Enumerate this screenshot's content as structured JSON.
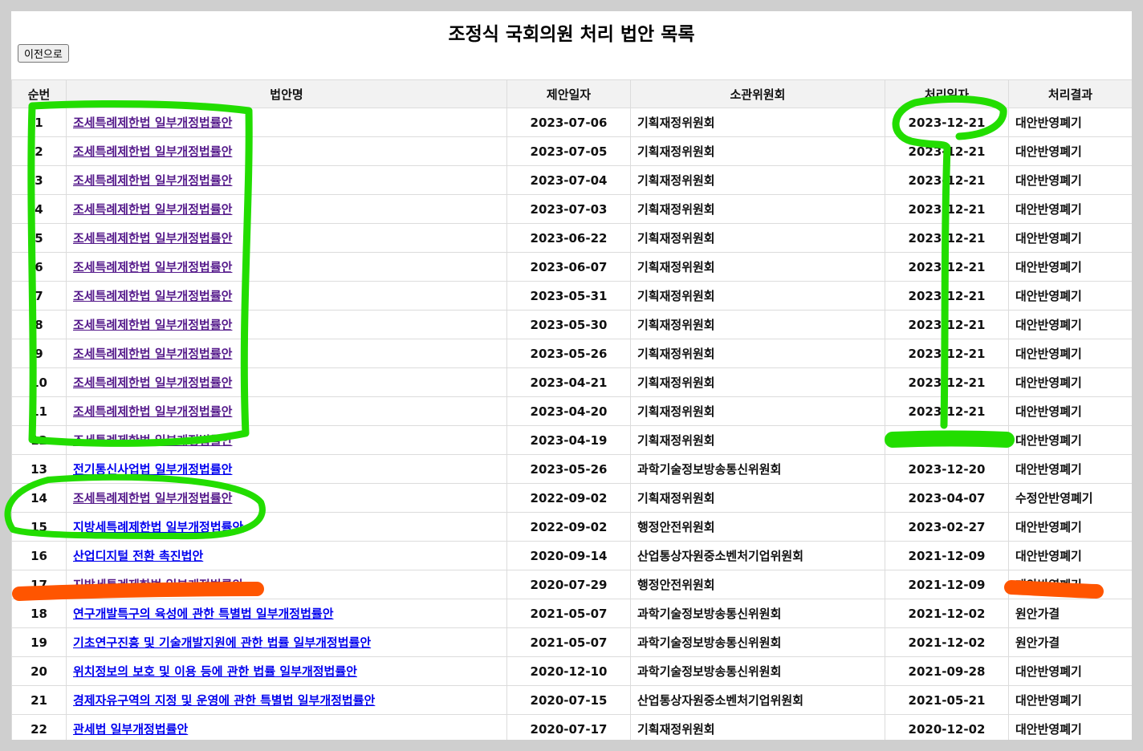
{
  "page": {
    "title": "조정식 국회의원 처리 법안 목록",
    "back_label": "이전으로"
  },
  "table": {
    "headers": {
      "no": "순번",
      "name": "법안명",
      "proposed": "제안일자",
      "committee": "소관위원회",
      "processed": "처리일자",
      "result": "처리결과"
    },
    "rows": [
      {
        "no": "1",
        "name": "조세특례제한법 일부개정법률안",
        "proposed": "2023-07-06",
        "committee": "기획재정위원회",
        "processed": "2023-12-21",
        "result": "대안반영폐기",
        "visited": true
      },
      {
        "no": "2",
        "name": "조세특례제한법 일부개정법률안",
        "proposed": "2023-07-05",
        "committee": "기획재정위원회",
        "processed": "2023-12-21",
        "result": "대안반영폐기",
        "visited": true
      },
      {
        "no": "3",
        "name": "조세특례제한법 일부개정법률안",
        "proposed": "2023-07-04",
        "committee": "기획재정위원회",
        "processed": "2023-12-21",
        "result": "대안반영폐기",
        "visited": true
      },
      {
        "no": "4",
        "name": "조세특례제한법 일부개정법률안",
        "proposed": "2023-07-03",
        "committee": "기획재정위원회",
        "processed": "2023-12-21",
        "result": "대안반영폐기",
        "visited": true
      },
      {
        "no": "5",
        "name": "조세특례제한법 일부개정법률안",
        "proposed": "2023-06-22",
        "committee": "기획재정위원회",
        "processed": "2023-12-21",
        "result": "대안반영폐기",
        "visited": true
      },
      {
        "no": "6",
        "name": "조세특례제한법 일부개정법률안",
        "proposed": "2023-06-07",
        "committee": "기획재정위원회",
        "processed": "2023-12-21",
        "result": "대안반영폐기",
        "visited": true
      },
      {
        "no": "7",
        "name": "조세특례제한법 일부개정법률안",
        "proposed": "2023-05-31",
        "committee": "기획재정위원회",
        "processed": "2023-12-21",
        "result": "대안반영폐기",
        "visited": true
      },
      {
        "no": "8",
        "name": "조세특례제한법 일부개정법률안",
        "proposed": "2023-05-30",
        "committee": "기획재정위원회",
        "processed": "2023-12-21",
        "result": "대안반영폐기",
        "visited": true
      },
      {
        "no": "9",
        "name": "조세특례제한법 일부개정법률안",
        "proposed": "2023-05-26",
        "committee": "기획재정위원회",
        "processed": "2023-12-21",
        "result": "대안반영폐기",
        "visited": true
      },
      {
        "no": "10",
        "name": "조세특례제한법 일부개정법률안",
        "proposed": "2023-04-21",
        "committee": "기획재정위원회",
        "processed": "2023-12-21",
        "result": "대안반영폐기",
        "visited": true
      },
      {
        "no": "11",
        "name": "조세특례제한법 일부개정법률안",
        "proposed": "2023-04-20",
        "committee": "기획재정위원회",
        "processed": "2023-12-21",
        "result": "대안반영폐기",
        "visited": true
      },
      {
        "no": "12",
        "name": "조세특례제한법 일부개정법률안",
        "proposed": "2023-04-19",
        "committee": "기획재정위원회",
        "processed": "2023-12-21",
        "result": "대안반영폐기",
        "visited": true
      },
      {
        "no": "13",
        "name": "전기통신사업법 일부개정법률안",
        "proposed": "2023-05-26",
        "committee": "과학기술정보방송통신위원회",
        "processed": "2023-12-20",
        "result": "대안반영폐기",
        "visited": false
      },
      {
        "no": "14",
        "name": "조세특례제한법 일부개정법률안",
        "proposed": "2022-09-02",
        "committee": "기획재정위원회",
        "processed": "2023-04-07",
        "result": "수정안반영폐기",
        "visited": true
      },
      {
        "no": "15",
        "name": "지방세특례제한법 일부개정법률안",
        "proposed": "2022-09-02",
        "committee": "행정안전위원회",
        "processed": "2023-02-27",
        "result": "대안반영폐기",
        "visited": false
      },
      {
        "no": "16",
        "name": "산업디지털 전환 촉진법안",
        "proposed": "2020-09-14",
        "committee": "산업통상자원중소벤처기업위원회",
        "processed": "2021-12-09",
        "result": "대안반영폐기",
        "visited": false
      },
      {
        "no": "17",
        "name": "지방세특례제한법 일부개정법률안",
        "proposed": "2020-07-29",
        "committee": "행정안전위원회",
        "processed": "2021-12-09",
        "result": "대안반영폐기",
        "visited": true
      },
      {
        "no": "18",
        "name": "연구개발특구의 육성에 관한 특별법 일부개정법률안",
        "proposed": "2021-05-07",
        "committee": "과학기술정보방송통신위원회",
        "processed": "2021-12-02",
        "result": "원안가결",
        "visited": false
      },
      {
        "no": "19",
        "name": "기초연구진흥 및 기술개발지원에 관한 법률 일부개정법률안",
        "proposed": "2021-05-07",
        "committee": "과학기술정보방송통신위원회",
        "processed": "2021-12-02",
        "result": "원안가결",
        "visited": false
      },
      {
        "no": "20",
        "name": "위치정보의 보호 및 이용 등에 관한 법률 일부개정법률안",
        "proposed": "2020-12-10",
        "committee": "과학기술정보방송통신위원회",
        "processed": "2021-09-28",
        "result": "대안반영폐기",
        "visited": false
      },
      {
        "no": "21",
        "name": "경제자유구역의 지정 및 운영에 관한 특별법 일부개정법률안",
        "proposed": "2020-07-15",
        "committee": "산업통상자원중소벤처기업위원회",
        "processed": "2021-05-21",
        "result": "대안반영폐기",
        "visited": false
      },
      {
        "no": "22",
        "name": "관세법 일부개정법률안",
        "proposed": "2020-07-17",
        "committee": "기획재정위원회",
        "processed": "2020-12-02",
        "result": "대안반영폐기",
        "visited": false
      }
    ]
  },
  "colors": {
    "link": "#0000ee",
    "link_visited": "#551a8b",
    "highlight_green": "#22dd00",
    "highlight_orange": "#ff5500"
  }
}
